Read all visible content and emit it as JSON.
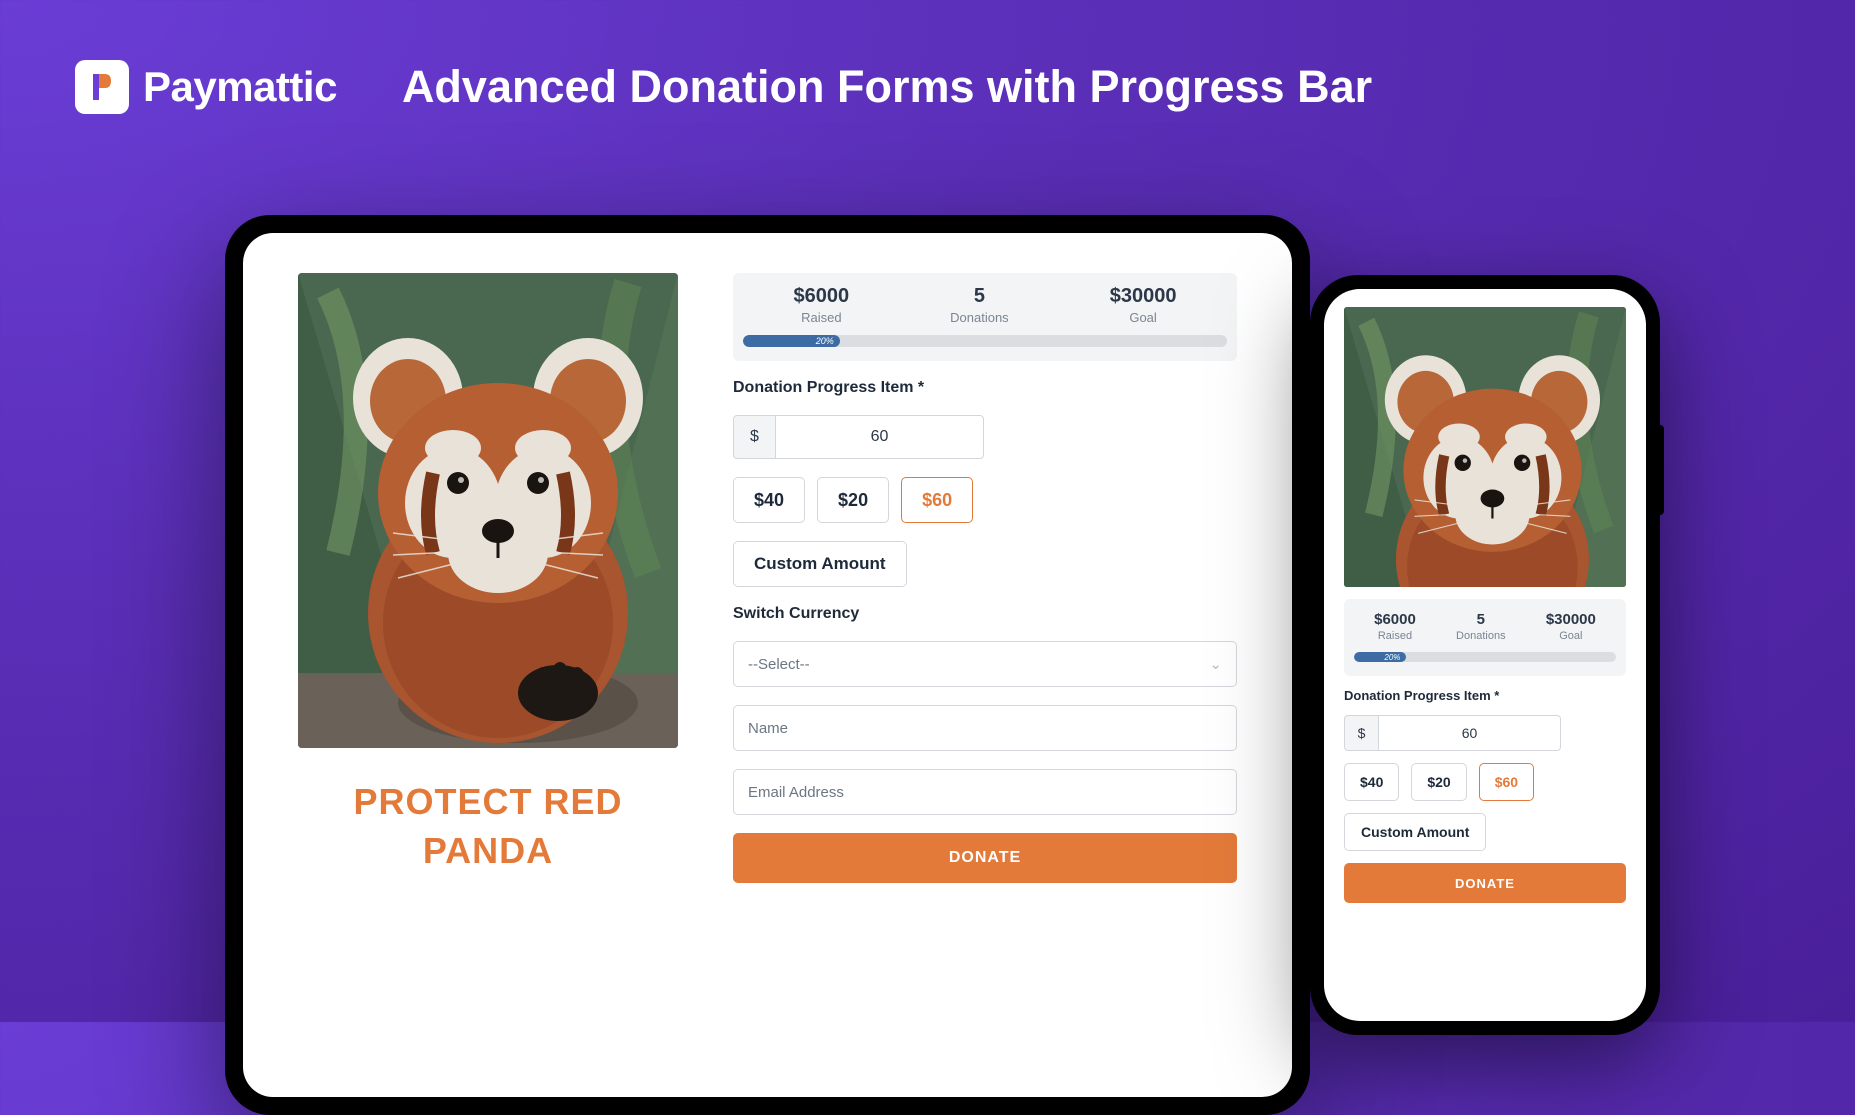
{
  "brand": {
    "name": "Paymattic"
  },
  "headline": "Advanced Donation Forms with Progress Bar",
  "campaign_title": "PROTECT RED PANDA",
  "stats": {
    "raised_value": "$6000",
    "raised_label": "Raised",
    "donations_value": "5",
    "donations_label": "Donations",
    "goal_value": "$30000",
    "goal_label": "Goal",
    "progress_pct": "20%"
  },
  "form": {
    "progress_label": "Donation Progress Item *",
    "currency_symbol": "$",
    "amount_value": "60",
    "options": [
      "$40",
      "$20",
      "$60"
    ],
    "selected_index": 2,
    "custom_label": "Custom Amount",
    "currency_label": "Switch Currency",
    "currency_placeholder": "--Select--",
    "name_placeholder": "Name",
    "email_placeholder": "Email Address",
    "donate_label": "DONATE"
  }
}
